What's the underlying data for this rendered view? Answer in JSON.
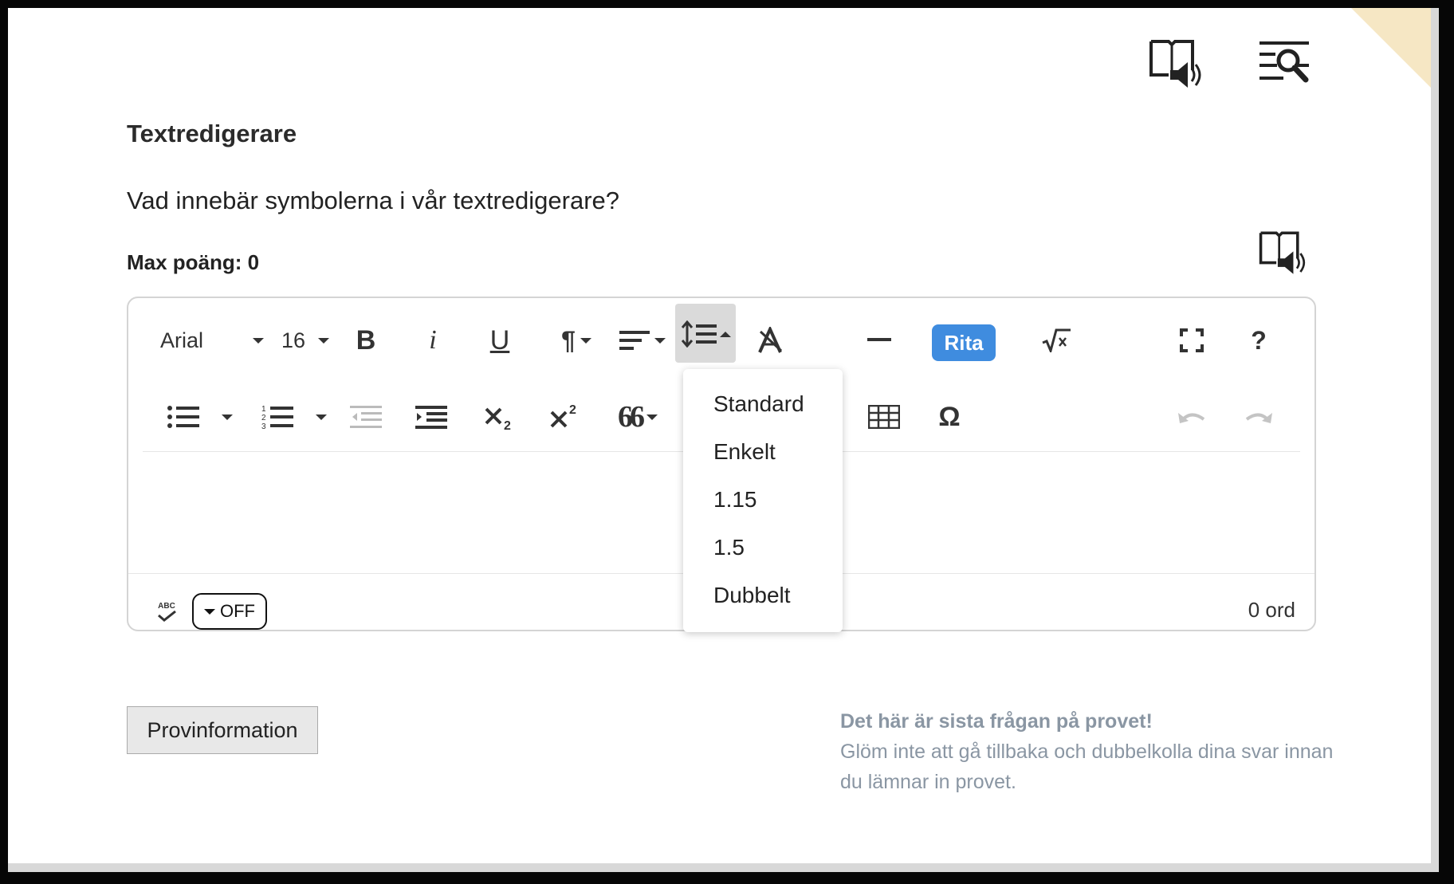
{
  "question": {
    "title": "Textredigerare",
    "text": "Vad innebär symbolerna i vår textredigerare?",
    "max_points": "Max poäng: 0"
  },
  "header_icons": [
    "read-aloud-icon",
    "text-search-icon"
  ],
  "toolbar": {
    "font_family": "Arial",
    "font_size": "16",
    "bold_label": "B",
    "italic_label": "i",
    "underline_label": "U",
    "paragraph_label": "¶",
    "rita_label": "Rita",
    "help_label": "?",
    "omega_label": "Ω",
    "quote_label": "66"
  },
  "line_height_menu": {
    "options": [
      "Standard",
      "Enkelt",
      "1.15",
      "1.5",
      "Dubbelt"
    ]
  },
  "status_bar": {
    "spellcheck_abc": "ABC",
    "spellcheck_state": "OFF",
    "word_count": "0 ord"
  },
  "footer": {
    "info_button": "Provinformation",
    "notice_title": "Det här är sista frågan på provet!",
    "notice_body": "Glöm inte att gå tillbaka och dubbelkolla dina svar innan du lämnar in provet."
  },
  "colors": {
    "accent": "#3f8cdf",
    "notice_text": "#8a96a3",
    "corner": "#f6e7c4"
  }
}
